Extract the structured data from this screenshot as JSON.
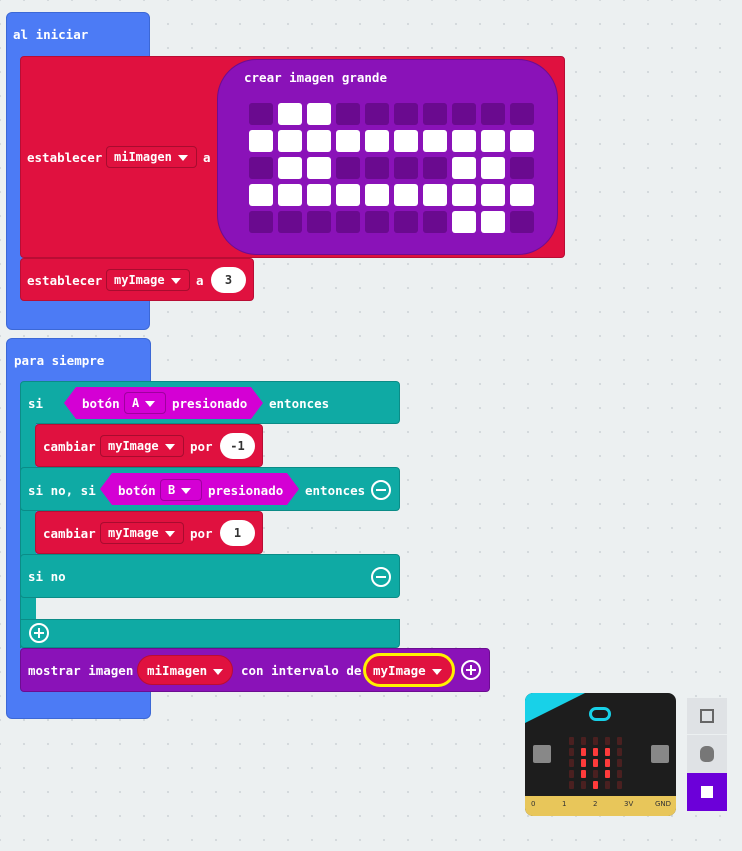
{
  "blocks": {
    "on_start": {
      "label": "al iniciar",
      "set1": {
        "label": "establecer",
        "variable": "miImagen",
        "to": "a"
      },
      "big_image": {
        "label": "crear imagen grande",
        "grid": [
          [
            0,
            1,
            1,
            0,
            0,
            0,
            0,
            0,
            0,
            0
          ],
          [
            1,
            1,
            1,
            1,
            1,
            1,
            1,
            1,
            1,
            1
          ],
          [
            0,
            1,
            1,
            0,
            0,
            0,
            0,
            1,
            1,
            0
          ],
          [
            1,
            1,
            1,
            1,
            1,
            1,
            1,
            1,
            1,
            1
          ],
          [
            0,
            0,
            0,
            0,
            0,
            0,
            0,
            1,
            1,
            0
          ]
        ]
      },
      "set2": {
        "label": "establecer",
        "variable": "myImage",
        "to": "a",
        "value": "3"
      }
    },
    "forever": {
      "label": "para siempre",
      "if_label": "si",
      "button_a": {
        "label": "botón",
        "button": "A",
        "state": "presionado"
      },
      "then_label": "entonces",
      "change1": {
        "label": "cambiar",
        "variable": "myImage",
        "by": "por",
        "value": "-1"
      },
      "else_if_label": "si no, si",
      "button_b": {
        "label": "botón",
        "button": "B",
        "state": "presionado"
      },
      "then_label2": "entonces",
      "change2": {
        "label": "cambiar",
        "variable": "myImage",
        "by": "por",
        "value": "1"
      },
      "else_label": "si no",
      "show": {
        "label": "mostrar imagen",
        "image": "miImagen",
        "interval_label": "con intervalo de",
        "interval": "myImage"
      }
    }
  },
  "simulator": {
    "pins": [
      "0",
      "1",
      "2",
      "3V",
      "GND"
    ],
    "led_grid": [
      [
        0,
        0,
        0,
        0,
        0
      ],
      [
        0,
        1,
        1,
        1,
        0
      ],
      [
        0,
        1,
        1,
        1,
        0
      ],
      [
        0,
        1,
        0,
        1,
        0
      ],
      [
        0,
        0,
        1,
        0,
        0
      ]
    ],
    "controls": [
      "fullscreen-icon",
      "debug-icon",
      "stop-icon"
    ]
  },
  "colors": {
    "events": "#4c7bf5",
    "variables": "#e0113f",
    "logic": "#0faaa4",
    "images": "#8a12b8",
    "input": "#d400d4"
  }
}
